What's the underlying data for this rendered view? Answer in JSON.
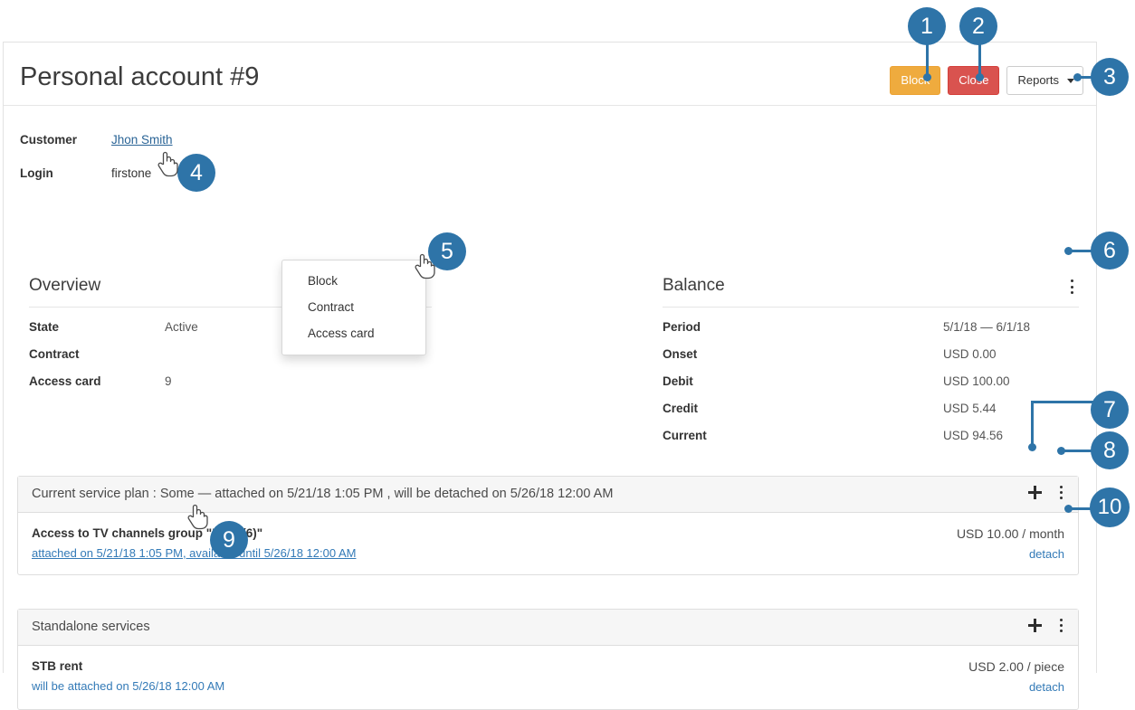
{
  "page": {
    "title": "Personal account #9"
  },
  "header": {
    "buttons": {
      "block": "Block",
      "close": "Close",
      "reports": "Reports"
    }
  },
  "info": {
    "rows": [
      {
        "label": "Customer",
        "value": "Jhon Smith",
        "is_link": true
      },
      {
        "label": "Login",
        "value": "firstone",
        "is_link": false
      }
    ]
  },
  "overview": {
    "title": "Overview",
    "rows": [
      {
        "key": "State",
        "value": "Active"
      },
      {
        "key": "Contract",
        "value": ""
      },
      {
        "key": "Access card",
        "value": "9"
      }
    ]
  },
  "balance": {
    "title": "Balance",
    "rows": [
      {
        "key": "Period",
        "value": "5/1/18  —  6/1/18"
      },
      {
        "key": "Onset",
        "value": "USD 0.00"
      },
      {
        "key": "Debit",
        "value": "USD 100.00"
      },
      {
        "key": "Credit",
        "value": "USD 5.44"
      },
      {
        "key": "Current",
        "value": "USD 94.56"
      }
    ]
  },
  "dropdown": {
    "items": [
      "Block",
      "Contract",
      "Access card"
    ]
  },
  "service_plan": {
    "header": "Current service plan : Some —  attached on  5/21/18 1:05 PM , will be detached on  5/26/18 12:00 AM",
    "service": {
      "name": "Access to TV channels group \"Kids (6)\"",
      "sub": "attached on 5/21/18 1:05 PM, available until 5/26/18 12:00 AM",
      "price": "USD 10.00 / month",
      "detach": "detach"
    }
  },
  "standalone": {
    "header": "Standalone services",
    "service": {
      "name": "STB rent",
      "sub": "will be attached on 5/26/18 12:00 AM",
      "price": "USD 2.00 / piece",
      "detach": "detach"
    }
  },
  "callouts": [
    {
      "n": "1"
    },
    {
      "n": "2"
    },
    {
      "n": "3"
    },
    {
      "n": "4"
    },
    {
      "n": "5"
    },
    {
      "n": "6"
    },
    {
      "n": "7"
    },
    {
      "n": "8"
    },
    {
      "n": "9"
    },
    {
      "n": "10"
    }
  ],
  "colors": {
    "badge": "#2e74a8",
    "block_button": "#efab3e",
    "close_button": "#d9534f",
    "link": "#337ab7"
  }
}
